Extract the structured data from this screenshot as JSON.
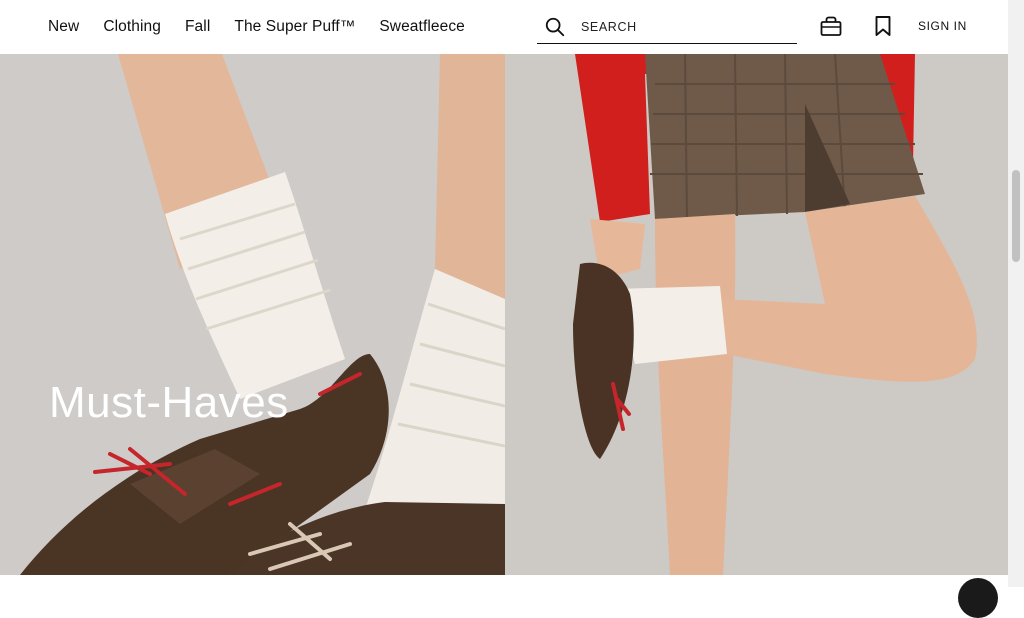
{
  "nav": {
    "items": [
      {
        "label": "New"
      },
      {
        "label": "Clothing"
      },
      {
        "label": "Fall"
      },
      {
        "label": "The Super Puff™"
      },
      {
        "label": "Sweatfleece"
      }
    ]
  },
  "search": {
    "placeholder": "SEARCH",
    "icon": "search-icon"
  },
  "header": {
    "bag_icon": "shopping-bag-icon",
    "wishlist_icon": "bookmark-icon",
    "signin_label": "SIGN IN"
  },
  "hero": {
    "title": "Must-Haves"
  },
  "colors": {
    "header_bg": "#ffffff",
    "text": "#111111",
    "hero_text": "#ffffff"
  }
}
